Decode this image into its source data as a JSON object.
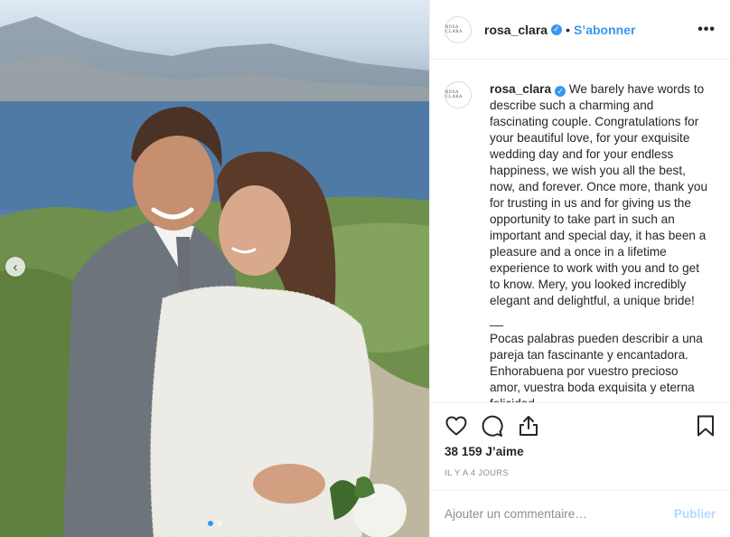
{
  "post": {
    "photo": {
      "alt_icon": "wedding-photo",
      "carousel_prev_symbol": "‹",
      "carousel_dots": 2,
      "active_dot": 0
    },
    "header": {
      "avatar_text": "ROSA CLARA",
      "username": "rosa_clara",
      "verified_symbol": "✓",
      "separator": "•",
      "follow_label": "S’abonner",
      "more_icon": "more-horizontal-icon",
      "more_symbol": "•••"
    },
    "caption": {
      "username": "rosa_clara",
      "text_en": "We barely have words to describe such a charming and fascinating couple. Congratulations for your beautiful love, for your exquisite wedding day and for your endless happiness, we wish you all the best, now, and forever. Once more, thank you for trusting in us and for giving us the opportunity to take part in such an important and special day, it has been a pleasure and a once in a lifetime experience to work with you and to get to know. Mery, you looked incredibly elegant and delightful, a unique bride!",
      "divider": "__",
      "text_es": "Pocas palabras pueden describir a una pareja tan fascinante y encantadora. Enhorabuena por vuestro precioso amor, vuestra boda exquisita y eterna felicidad"
    },
    "actions": {
      "like_icon": "heart-icon",
      "comment_icon": "comment-icon",
      "share_icon": "share-icon",
      "save_icon": "bookmark-icon"
    },
    "likes_text": "38 159 J’aime",
    "timestamp": "IL Y A 4 JOURS",
    "comment": {
      "placeholder": "Ajouter un commentaire…",
      "publish_label": "Publier"
    }
  },
  "colors": {
    "accent": "#3897f0",
    "publish_disabled": "#b3dbff",
    "text": "#262626",
    "muted": "#8e8e8e",
    "border": "#efefef"
  }
}
